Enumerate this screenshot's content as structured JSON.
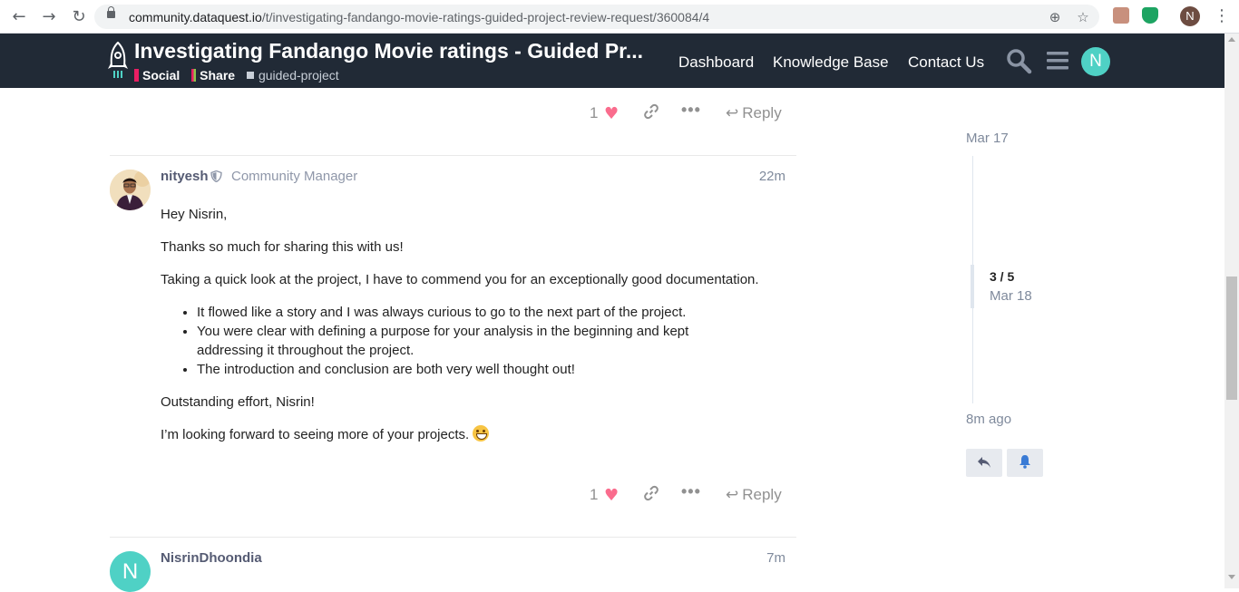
{
  "browser": {
    "url_host": "community.dataquest.io",
    "url_path": "/t/investigating-fandango-movie-ratings-guided-project-review-request/360084/4",
    "profile_initial": "N"
  },
  "header": {
    "title": "Investigating Fandango Movie ratings - Guided Pr...",
    "categories": [
      {
        "label": "Social",
        "color": "#e45735"
      },
      {
        "label": "Share",
        "color": "#8bc34a"
      }
    ],
    "tag": "guided-project",
    "nav": [
      "Dashboard",
      "Knowledge Base",
      "Contact Us"
    ],
    "user_initial": "N",
    "colors": {
      "bg": "#212a36",
      "avatar": "#4fd1c5"
    }
  },
  "prev_post_actions": {
    "like_count": "1",
    "reply_label": "Reply"
  },
  "post": {
    "username": "nityesh",
    "user_title": "Community Manager",
    "time": "22m",
    "greeting": "Hey Nisrin,",
    "p1": "Thanks so much for sharing this with us!",
    "p2": "Taking a quick look at the project, I have to commend you for an exceptionally good documentation.",
    "bullets": [
      "It flowed like a story and I was always curious to go to the next part of the project.",
      "You were clear with defining a purpose for your analysis in the beginning and kept addressing it throughout the project.",
      "The introduction and conclusion are both very well thought out!"
    ],
    "p3": "Outstanding effort, Nisrin!",
    "p4": "I’m looking forward to seeing more of your projects.",
    "like_count": "1",
    "reply_label": "Reply"
  },
  "next_post": {
    "avatar_initial": "N",
    "username": "NisrinDhoondia",
    "time": "7m"
  },
  "timeline": {
    "start_date": "Mar 17",
    "position": "3 / 5",
    "position_date": "Mar 18",
    "end_label": "8m ago"
  }
}
